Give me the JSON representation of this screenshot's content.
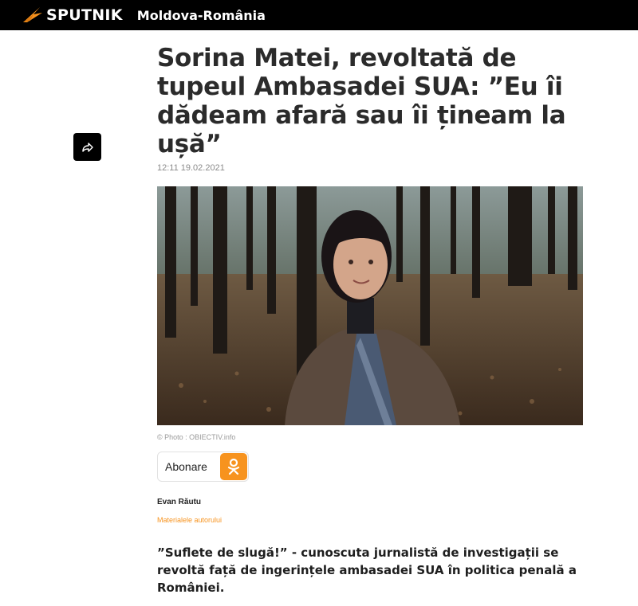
{
  "header": {
    "brand": "SPUTNIK",
    "edition": "Moldova-România",
    "logo_icon": "sputnik-logo-icon",
    "accent_color": "#f7931e"
  },
  "share": {
    "icon": "share-arrow-icon"
  },
  "article": {
    "title": "Sorina Matei, revoltată de tupeul Ambasadei SUA: ”Eu îi dădeam afară sau îi țineam la ușă”",
    "timestamp": "12:11 19.02.2021",
    "image_caption": "© Photo : OBIECTIV.info",
    "subscribe_label": "Abonare",
    "subscribe_icon": "odnoklassniki-icon",
    "author": "Evan Răutu",
    "author_link": "Materialele autorului",
    "lead": "”Suflete de slugă!” - cunoscuta jurnalistă de investigații se revoltă față de ingerințele ambasadei SUA în politica penală a României."
  }
}
